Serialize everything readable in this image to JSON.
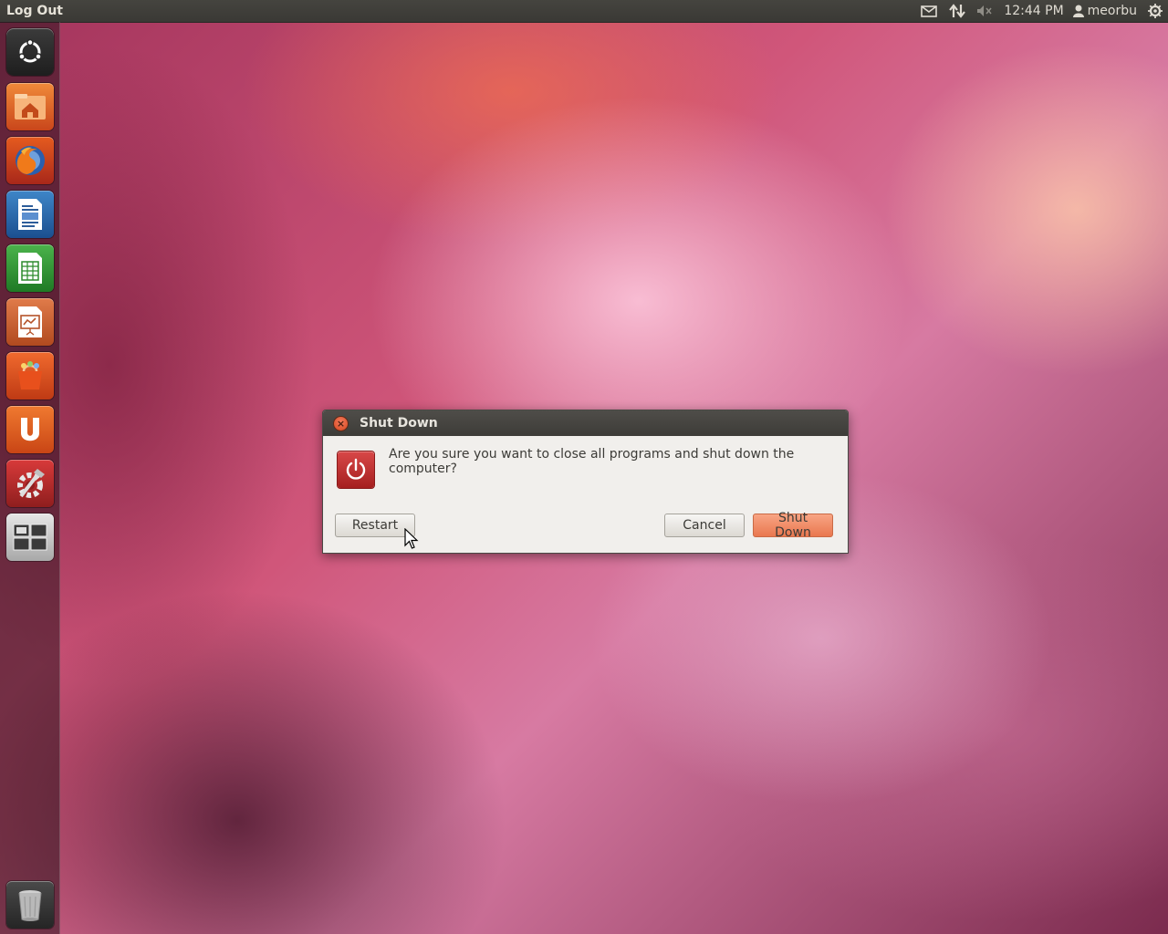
{
  "top_panel": {
    "app_title": "Log Out",
    "clock": "12:44 PM",
    "username": "meorbu",
    "icons": [
      "mail-icon",
      "network-icon",
      "sound-muted-icon",
      "user-icon",
      "gear-icon"
    ]
  },
  "launcher": {
    "items": [
      "dash-home-icon",
      "home-folder-icon",
      "firefox-icon",
      "writer-icon",
      "calc-icon",
      "impress-icon",
      "software-center-icon",
      "ubuntu-one-icon",
      "system-settings-icon",
      "workspace-switcher-icon",
      "trash-icon"
    ]
  },
  "dialog": {
    "title": "Shut Down",
    "message": "Are you sure you want to close all programs and shut down the computer?",
    "restart_label": "Restart",
    "cancel_label": "Cancel",
    "shutdown_label": "Shut Down"
  },
  "colors": {
    "panel": "#3c3b37",
    "dialog_bg": "#f1efec",
    "accent_button": "#f0885e",
    "power_icon": "#c0302c"
  }
}
